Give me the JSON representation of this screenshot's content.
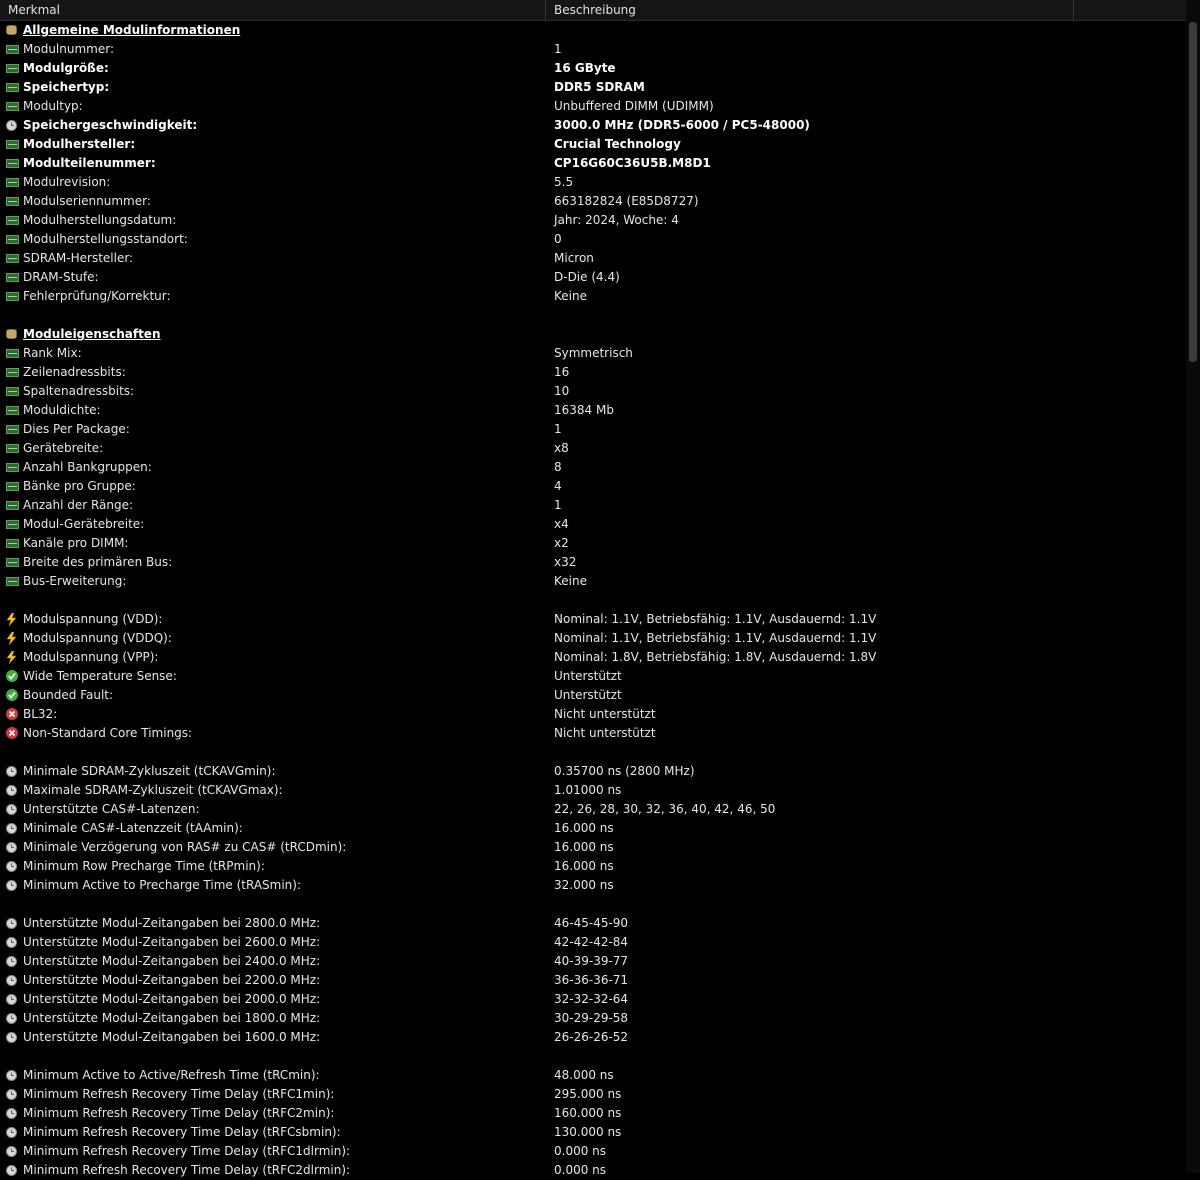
{
  "columns": {
    "col1": "Merkmal",
    "col2": "Beschreibung",
    "col3": ""
  },
  "rows": [
    {
      "type": "section",
      "icon": "database-icon",
      "label": "Allgemeine Modulinformationen",
      "value": ""
    },
    {
      "type": "row",
      "icon": "memory-chip-icon",
      "label": "Modulnummer:",
      "value": "1"
    },
    {
      "type": "bold",
      "icon": "memory-chip-icon",
      "label": "Modulgröße:",
      "value": "16 GByte"
    },
    {
      "type": "bold",
      "icon": "memory-chip-icon",
      "label": "Speichertyp:",
      "value": "DDR5 SDRAM"
    },
    {
      "type": "row",
      "icon": "memory-chip-icon",
      "label": "Modultyp:",
      "value": "Unbuffered DIMM (UDIMM)"
    },
    {
      "type": "bold",
      "icon": "clock-icon",
      "label": "Speichergeschwindigkeit:",
      "value": "3000.0 MHz (DDR5-6000 / PC5-48000)"
    },
    {
      "type": "bold",
      "icon": "memory-chip-icon",
      "label": "Modulhersteller:",
      "value": "Crucial Technology"
    },
    {
      "type": "bold",
      "icon": "memory-chip-icon",
      "label": "Modulteilenummer:",
      "value": "CP16G60C36U5B.M8D1"
    },
    {
      "type": "row",
      "icon": "memory-chip-icon",
      "label": "Modulrevision:",
      "value": "5.5"
    },
    {
      "type": "row",
      "icon": "memory-chip-icon",
      "label": "Modulseriennummer:",
      "value": "663182824 (E85D8727)"
    },
    {
      "type": "row",
      "icon": "memory-chip-icon",
      "label": "Modulherstellungsdatum:",
      "value": "Jahr: 2024, Woche: 4"
    },
    {
      "type": "row",
      "icon": "memory-chip-icon",
      "label": "Modulherstellungsstandort:",
      "value": "0"
    },
    {
      "type": "row",
      "icon": "memory-chip-icon",
      "label": "SDRAM-Hersteller:",
      "value": "Micron"
    },
    {
      "type": "row",
      "icon": "memory-chip-icon",
      "label": "DRAM-Stufe:",
      "value": "D-Die (4.4)"
    },
    {
      "type": "row",
      "icon": "memory-chip-icon",
      "label": "Fehlerprüfung/Korrektur:",
      "value": "Keine"
    },
    {
      "type": "blank",
      "icon": "",
      "label": "",
      "value": ""
    },
    {
      "type": "section",
      "icon": "database-icon",
      "label": "Moduleigenschaften",
      "value": ""
    },
    {
      "type": "row",
      "icon": "memory-chip-icon",
      "label": "Rank Mix:",
      "value": "Symmetrisch"
    },
    {
      "type": "row",
      "icon": "memory-chip-icon",
      "label": "Zeilenadressbits:",
      "value": "16"
    },
    {
      "type": "row",
      "icon": "memory-chip-icon",
      "label": "Spaltenadressbits:",
      "value": "10"
    },
    {
      "type": "row",
      "icon": "memory-chip-icon",
      "label": "Moduldichte:",
      "value": "16384 Mb"
    },
    {
      "type": "row",
      "icon": "memory-chip-icon",
      "label": "Dies Per Package:",
      "value": "1"
    },
    {
      "type": "row",
      "icon": "memory-chip-icon",
      "label": "Gerätebreite:",
      "value": "x8"
    },
    {
      "type": "row",
      "icon": "memory-chip-icon",
      "label": "Anzahl Bankgruppen:",
      "value": "8"
    },
    {
      "type": "row",
      "icon": "memory-chip-icon",
      "label": "Bänke pro Gruppe:",
      "value": "4"
    },
    {
      "type": "row",
      "icon": "memory-chip-icon",
      "label": "Anzahl der Ränge:",
      "value": "1"
    },
    {
      "type": "row",
      "icon": "memory-chip-icon",
      "label": "Modul-Gerätebreite:",
      "value": "x4"
    },
    {
      "type": "row",
      "icon": "memory-chip-icon",
      "label": "Kanäle pro DIMM:",
      "value": "x2"
    },
    {
      "type": "row",
      "icon": "memory-chip-icon",
      "label": "Breite des primären Bus:",
      "value": "x32"
    },
    {
      "type": "row",
      "icon": "memory-chip-icon",
      "label": "Bus-Erweiterung:",
      "value": "Keine"
    },
    {
      "type": "blank",
      "icon": "",
      "label": "",
      "value": ""
    },
    {
      "type": "row",
      "icon": "lightning-bolt-icon",
      "label": "Modulspannung (VDD):",
      "value": "Nominal: 1.1V, Betriebsfähig: 1.1V, Ausdauernd: 1.1V"
    },
    {
      "type": "row",
      "icon": "lightning-bolt-icon",
      "label": "Modulspannung (VDDQ):",
      "value": "Nominal: 1.1V, Betriebsfähig: 1.1V, Ausdauernd: 1.1V"
    },
    {
      "type": "row",
      "icon": "lightning-bolt-icon",
      "label": "Modulspannung (VPP):",
      "value": "Nominal: 1.8V, Betriebsfähig: 1.8V, Ausdauernd: 1.8V"
    },
    {
      "type": "row",
      "icon": "check-icon",
      "label": "Wide Temperature Sense:",
      "value": "Unterstützt"
    },
    {
      "type": "row",
      "icon": "check-icon",
      "label": "Bounded Fault:",
      "value": "Unterstützt"
    },
    {
      "type": "row",
      "icon": "error-icon",
      "label": "BL32:",
      "value": "Nicht unterstützt"
    },
    {
      "type": "row",
      "icon": "error-icon",
      "label": "Non-Standard Core Timings:",
      "value": "Nicht unterstützt"
    },
    {
      "type": "blank",
      "icon": "",
      "label": "",
      "value": ""
    },
    {
      "type": "row",
      "icon": "clock-icon",
      "label": "Minimale SDRAM-Zykluszeit (tCKAVGmin):",
      "value": "0.35700 ns (2800 MHz)"
    },
    {
      "type": "row",
      "icon": "clock-icon",
      "label": "Maximale SDRAM-Zykluszeit (tCKAVGmax):",
      "value": "1.01000 ns"
    },
    {
      "type": "row",
      "icon": "clock-icon",
      "label": "Unterstützte CAS#-Latenzen:",
      "value": "22, 26, 28, 30, 32, 36, 40, 42, 46, 50"
    },
    {
      "type": "row",
      "icon": "clock-icon",
      "label": "Minimale CAS#-Latenzzeit (tAAmin):",
      "value": "16.000 ns"
    },
    {
      "type": "row",
      "icon": "clock-icon",
      "label": "Minimale Verzögerung von RAS# zu CAS# (tRCDmin):",
      "value": "16.000 ns"
    },
    {
      "type": "row",
      "icon": "clock-icon",
      "label": "Minimum Row Precharge Time (tRPmin):",
      "value": "16.000 ns"
    },
    {
      "type": "row",
      "icon": "clock-icon",
      "label": "Minimum Active to Precharge Time (tRASmin):",
      "value": "32.000 ns"
    },
    {
      "type": "blank",
      "icon": "",
      "label": "",
      "value": ""
    },
    {
      "type": "row",
      "icon": "clock-icon",
      "label": "Unterstützte Modul-Zeitangaben bei 2800.0 MHz:",
      "value": "46-45-45-90"
    },
    {
      "type": "row",
      "icon": "clock-icon",
      "label": "Unterstützte Modul-Zeitangaben bei 2600.0 MHz:",
      "value": "42-42-42-84"
    },
    {
      "type": "row",
      "icon": "clock-icon",
      "label": "Unterstützte Modul-Zeitangaben bei 2400.0 MHz:",
      "value": "40-39-39-77"
    },
    {
      "type": "row",
      "icon": "clock-icon",
      "label": "Unterstützte Modul-Zeitangaben bei 2200.0 MHz:",
      "value": "36-36-36-71"
    },
    {
      "type": "row",
      "icon": "clock-icon",
      "label": "Unterstützte Modul-Zeitangaben bei 2000.0 MHz:",
      "value": "32-32-32-64"
    },
    {
      "type": "row",
      "icon": "clock-icon",
      "label": "Unterstützte Modul-Zeitangaben bei 1800.0 MHz:",
      "value": "30-29-29-58"
    },
    {
      "type": "row",
      "icon": "clock-icon",
      "label": "Unterstützte Modul-Zeitangaben bei 1600.0 MHz:",
      "value": "26-26-26-52"
    },
    {
      "type": "blank",
      "icon": "",
      "label": "",
      "value": ""
    },
    {
      "type": "row",
      "icon": "clock-icon",
      "label": "Minimum Active to Active/Refresh Time (tRCmin):",
      "value": "48.000 ns"
    },
    {
      "type": "row",
      "icon": "clock-icon",
      "label": "Minimum Refresh Recovery Time Delay (tRFC1min):",
      "value": "295.000 ns"
    },
    {
      "type": "row",
      "icon": "clock-icon",
      "label": "Minimum Refresh Recovery Time Delay (tRFC2min):",
      "value": "160.000 ns"
    },
    {
      "type": "row",
      "icon": "clock-icon",
      "label": "Minimum Refresh Recovery Time Delay (tRFCsbmin):",
      "value": "130.000 ns"
    },
    {
      "type": "row",
      "icon": "clock-icon",
      "label": "Minimum Refresh Recovery Time Delay (tRFC1dlrmin):",
      "value": "0.000 ns"
    },
    {
      "type": "row",
      "icon": "clock-icon",
      "label": "Minimum Refresh Recovery Time Delay (tRFC2dlrmin):",
      "value": "0.000 ns"
    }
  ]
}
